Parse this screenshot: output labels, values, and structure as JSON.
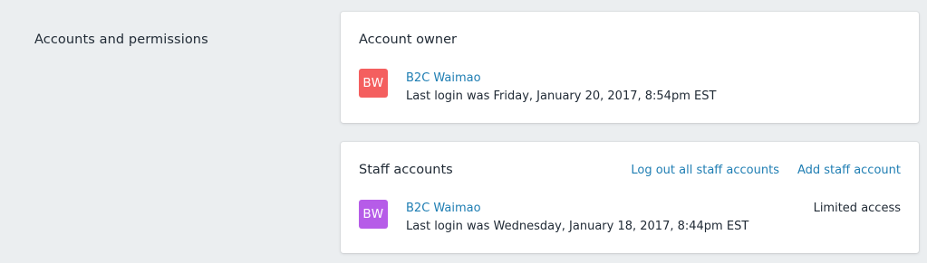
{
  "section": {
    "title": "Accounts and permissions"
  },
  "owner_card": {
    "title": "Account owner",
    "user": {
      "initials": "BW",
      "avatar_color": "#f45f5f",
      "name": "B2C Waimao",
      "last_login": "Last login was Friday, January 20, 2017, 8:54pm EST"
    }
  },
  "staff_card": {
    "title": "Staff accounts",
    "actions": {
      "logout_all": "Log out all staff accounts",
      "add_staff": "Add staff account"
    },
    "users": [
      {
        "initials": "BW",
        "avatar_color": "#b65ce8",
        "name": "B2C Waimao",
        "last_login": "Last login was Wednesday, January 18, 2017, 8:44pm EST",
        "access": "Limited access"
      }
    ]
  },
  "colors": {
    "background": "#ebeef0",
    "link": "#1f7eb3",
    "text": "#212b36"
  }
}
